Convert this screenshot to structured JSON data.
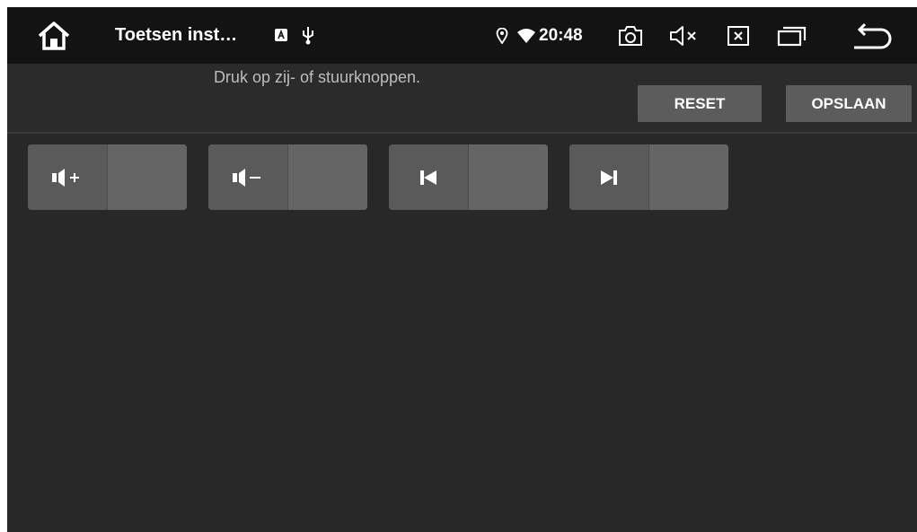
{
  "statusbar": {
    "title": "Toetsen inst…",
    "time": "20:48",
    "icons": {
      "home": "home-icon",
      "notification_a": "a-badge-icon",
      "usb": "usb-icon",
      "location": "location-pin-icon",
      "wifi": "wifi-icon",
      "camera": "camera-icon",
      "mute": "volume-mute-icon",
      "close": "close-window-icon",
      "recents": "recents-icon",
      "back": "back-icon"
    }
  },
  "header": {
    "instruction": "Druk op zij- of stuurknoppen.",
    "reset_label": "RESET",
    "save_label": "OPSLAAN"
  },
  "keys": [
    {
      "icon": "volume-up-icon"
    },
    {
      "icon": "volume-down-icon"
    },
    {
      "icon": "previous-track-icon"
    },
    {
      "icon": "next-track-icon"
    }
  ],
  "colors": {
    "background": "#282828",
    "statusbar": "#131313",
    "button": "#5c5c5c",
    "tile": "#5a5a5a",
    "text_dim": "#bdbdbd"
  }
}
